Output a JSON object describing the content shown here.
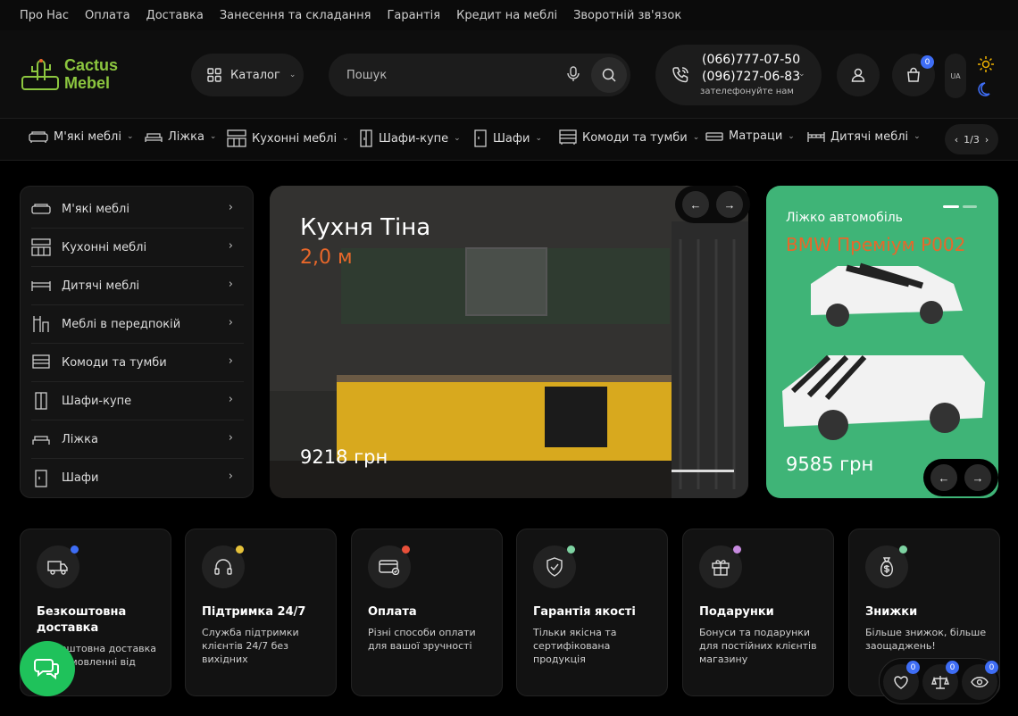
{
  "topbar": {
    "links": [
      "Про Нас",
      "Оплата",
      "Доставка",
      "Занесення та складання",
      "Гарантія",
      "Кредит на меблі",
      "Зворотній зв'язок"
    ]
  },
  "header": {
    "logo": {
      "line1": "Cactus",
      "line2": "Mebel"
    },
    "catalog_label": "Каталог",
    "search_placeholder": "Пошук",
    "phones": [
      "(066)777-07-50",
      "(096)727-06-83"
    ],
    "phone_note": "зателефонуйте нам",
    "cart_count": "0",
    "lang": "UA"
  },
  "catnav": {
    "items": [
      "М'які меблі",
      "Ліжка",
      "Кухонні меблі",
      "Шафи-купе",
      "Шафи",
      "Комоди та тумби",
      "Матраци",
      "Дитячі меблі"
    ],
    "pager": "1/3"
  },
  "sidemenu": {
    "items": [
      "М'які меблі",
      "Кухонні меблі",
      "Дитячі меблі",
      "Меблі в передпокій",
      "Комоди та тумби",
      "Шафи-купе",
      "Ліжка",
      "Шафи"
    ]
  },
  "hero": {
    "title": "Кухня Тіна",
    "subtitle": "2,0 м",
    "price": "9218 грн"
  },
  "promo": {
    "title": "Ліжко автомобіль",
    "name": "BMW Преміум P002",
    "price": "9585 грн"
  },
  "features": [
    {
      "title": "Безкоштовна доставка",
      "desc": "Безкоштовна доставка при замовленні від",
      "dot": "#3e6df5"
    },
    {
      "title": "Підтримка 24/7",
      "desc": "Служба підтримки клієнтів 24/7 без вихідних",
      "dot": "#e6c23a"
    },
    {
      "title": "Оплата",
      "desc": "Різні способи оплати для вашої зручності",
      "dot": "#e8503a"
    },
    {
      "title": "Гарантія якості",
      "desc": "Тільки якісна та сертифікована продукція",
      "dot": "#7ed3a2"
    },
    {
      "title": "Подарунки",
      "desc": "Бонуси та подарунки для постійних клієнтів магазину",
      "dot": "#c88be0"
    },
    {
      "title": "Знижки",
      "desc": "Більше знижок, більше заощаджень!",
      "dot": "#7ed3a2"
    }
  ],
  "floatbar": {
    "wishlist_count": "0",
    "compare_count": "0",
    "viewed_count": "0"
  },
  "colors": {
    "accent_green": "#3fb477",
    "accent_orange": "#e8672a",
    "badge_blue": "#3e6df5",
    "chat_green": "#1fc25b"
  }
}
